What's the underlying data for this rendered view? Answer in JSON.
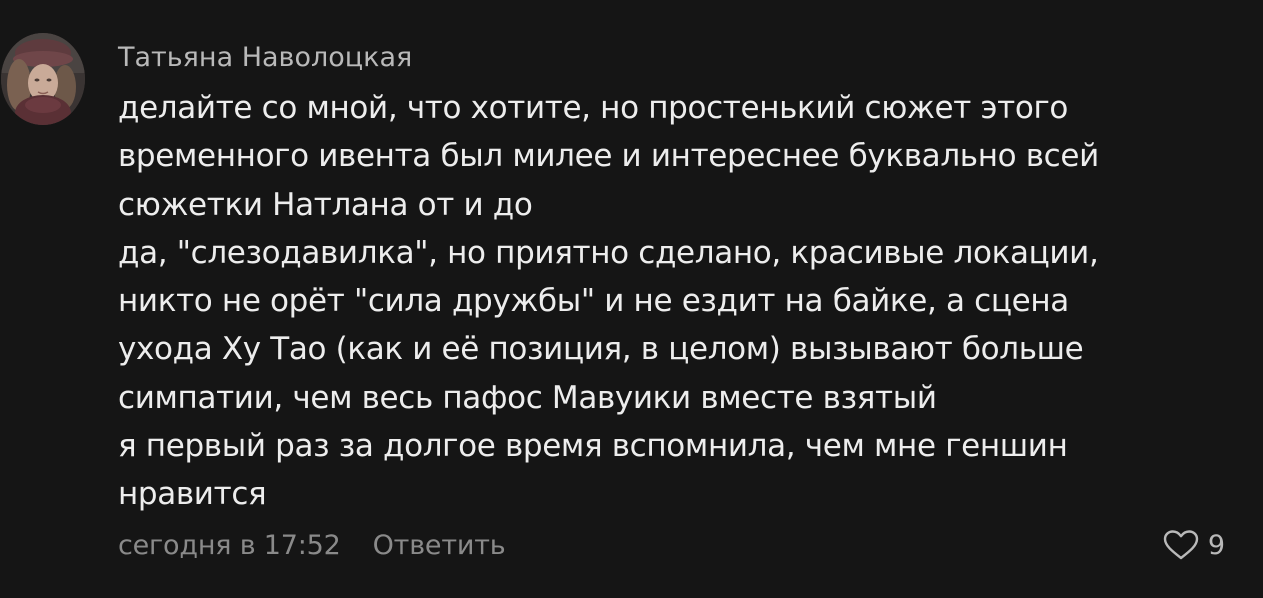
{
  "comment": {
    "author": "Татьяна Наволоцкая",
    "lines": [
      "делайте со мной, что хотите, но простенький сюжет этого",
      "временного ивента был милее и интереснее буквально всей",
      "сюжетки Натлана от и до",
      "да, \"слезодавилка\", но приятно сделано, красивые локации,",
      "никто не орёт \"сила дружбы\" и не ездит на байке, а сцена",
      "ухода Ху Тао (как и её позиция, в целом) вызывают больше",
      "симпатии, чем весь пафос Мавуики вместе взятый",
      "я первый раз за долгое время вспомнила, чем мне геншин",
      "нравится"
    ],
    "timestamp": "сегодня в 17:52",
    "reply_label": "Ответить",
    "like_count": "9",
    "like_icon": "heart-outline-icon"
  }
}
